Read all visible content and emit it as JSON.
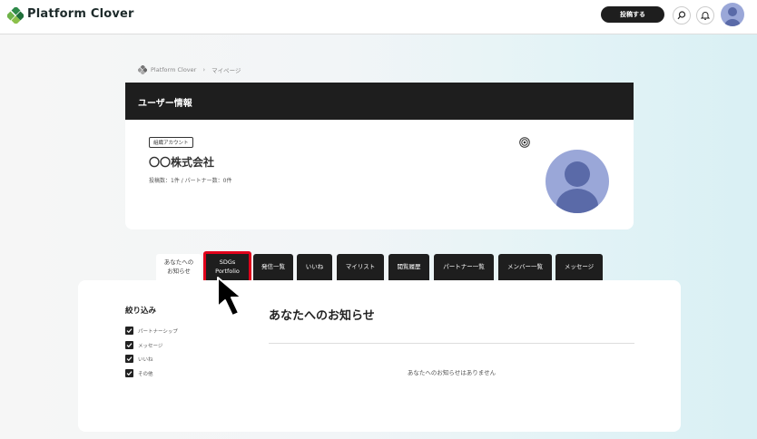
{
  "header": {
    "brand": "Platform Clover",
    "post_button": "投稿する",
    "icons": [
      "search-icon",
      "bell-icon",
      "user-avatar"
    ]
  },
  "breadcrumb": {
    "home": "Platform Clover",
    "current": "マイページ"
  },
  "user_card": {
    "header_title": "ユーザー情報",
    "badge": "組織アカウント",
    "name": "〇〇株式会社",
    "stats": "投稿数：1件 / パートナー数：0件"
  },
  "tabs": [
    {
      "label": "あなたへの\nお知らせ",
      "active": true
    },
    {
      "label": "SDGs\nPortfolio",
      "highlighted": true
    },
    {
      "label": "発信一覧"
    },
    {
      "label": "いいね"
    },
    {
      "label": "マイリスト"
    },
    {
      "label": "閲覧履歴"
    },
    {
      "label": "パートナー一覧"
    },
    {
      "label": "メンバー一覧"
    },
    {
      "label": "メッセージ"
    }
  ],
  "filter": {
    "title": "絞り込み",
    "items": [
      {
        "label": "パートナーシップ",
        "checked": true
      },
      {
        "label": "メッセージ",
        "checked": true
      },
      {
        "label": "いいね",
        "checked": true
      },
      {
        "label": "その他",
        "checked": true
      }
    ]
  },
  "notices": {
    "title": "あなたへのお知らせ",
    "empty_text": "あなたへのお知らせはありません"
  },
  "colors": {
    "dark": "#1e1e1e",
    "highlight": "#e0001b",
    "avatar": "#9aa7d8",
    "brand_green": "#3a9a4a"
  }
}
